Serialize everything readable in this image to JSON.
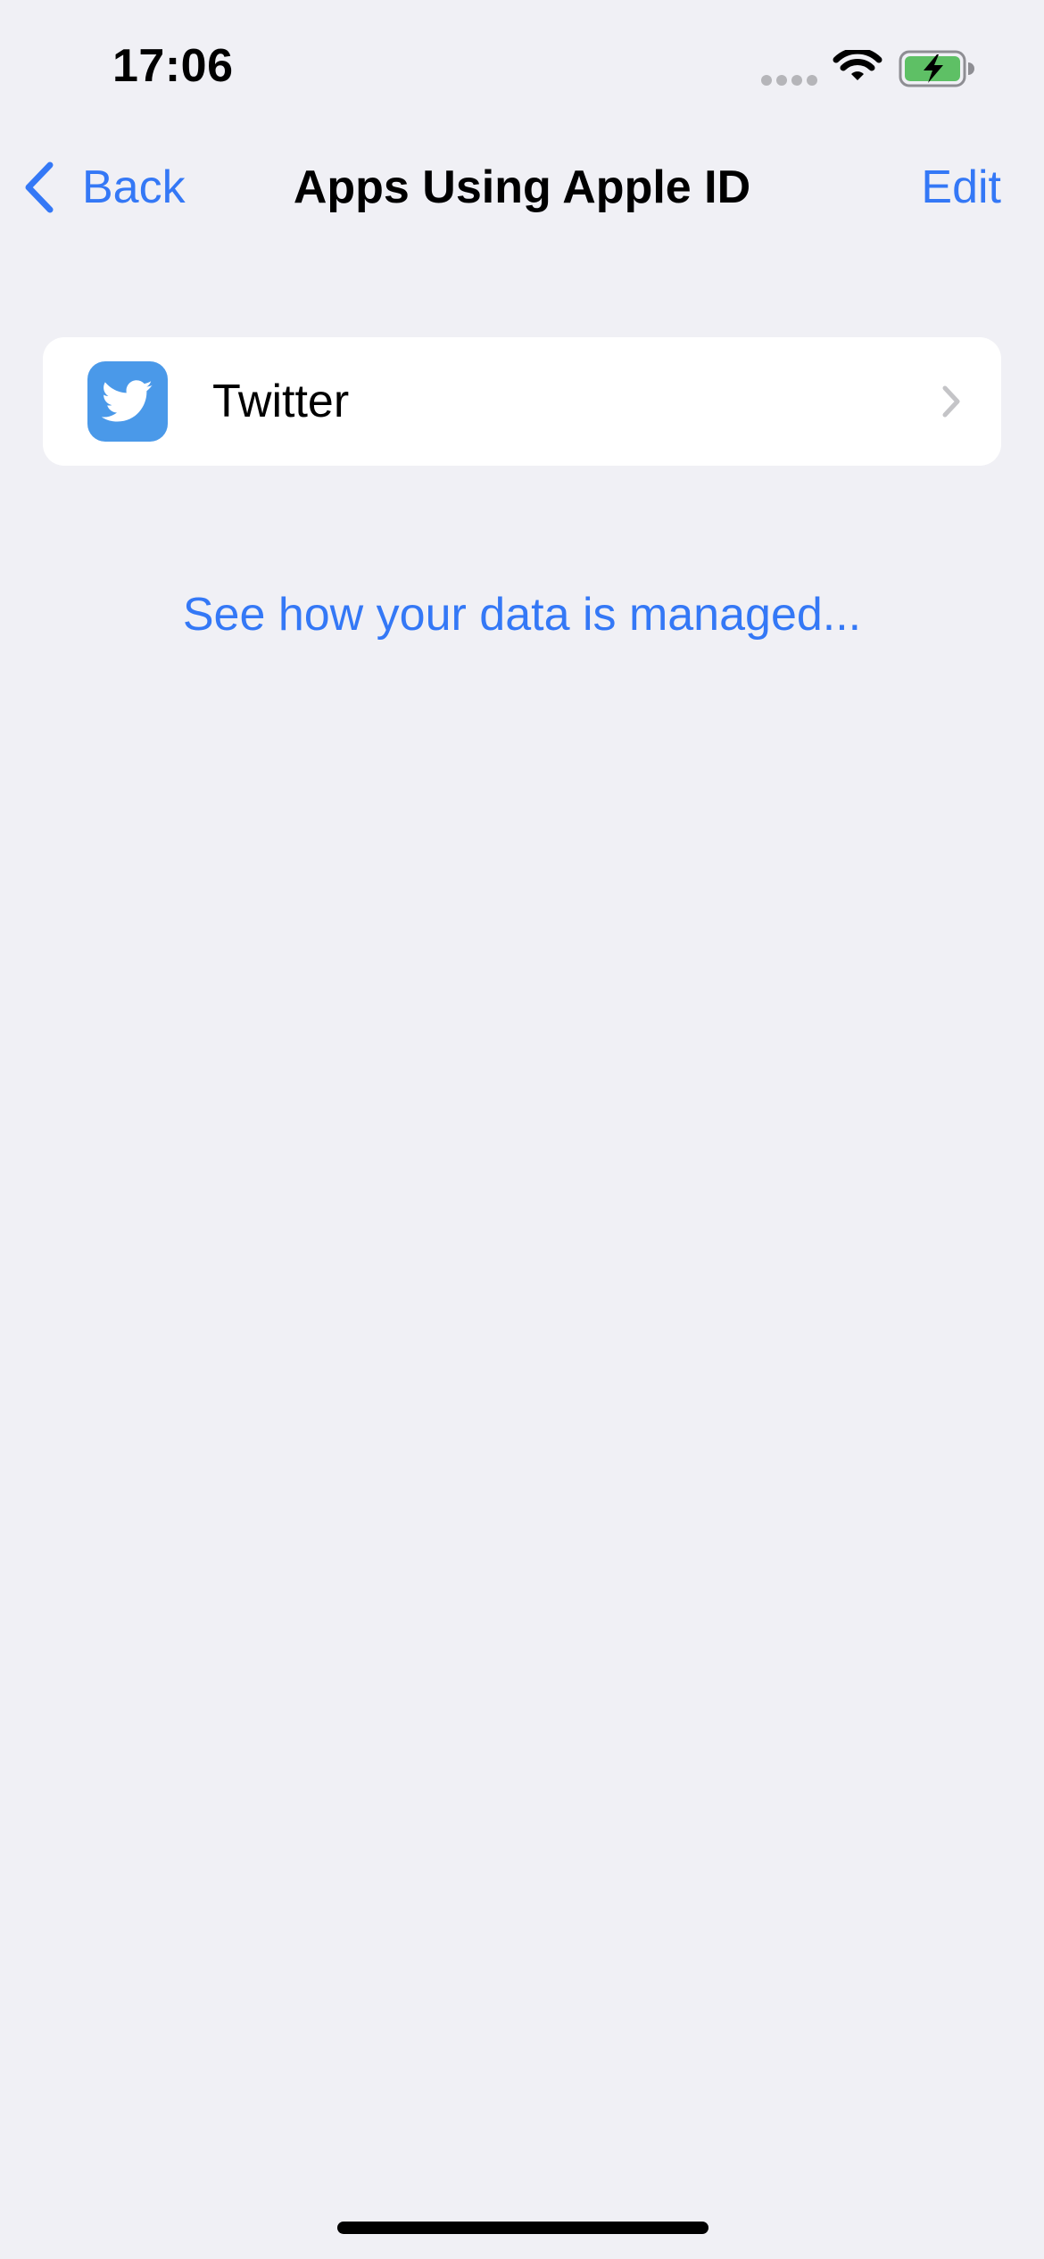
{
  "status_bar": {
    "time": "17:06",
    "icons": [
      "signal-dots-icon",
      "wifi-icon",
      "battery-charging-icon"
    ]
  },
  "nav": {
    "back_label": "Back",
    "title": "Apps Using Apple ID",
    "edit_label": "Edit"
  },
  "apps": [
    {
      "name": "Twitter",
      "icon": "twitter-bird-icon"
    }
  ],
  "footer_link": "See how your data is managed...",
  "colors": {
    "accent": "#3478f6",
    "background": "#f0f0f5",
    "card": "#ffffff",
    "twitter_blue": "#4a99e9",
    "battery_green": "#5ec065"
  }
}
